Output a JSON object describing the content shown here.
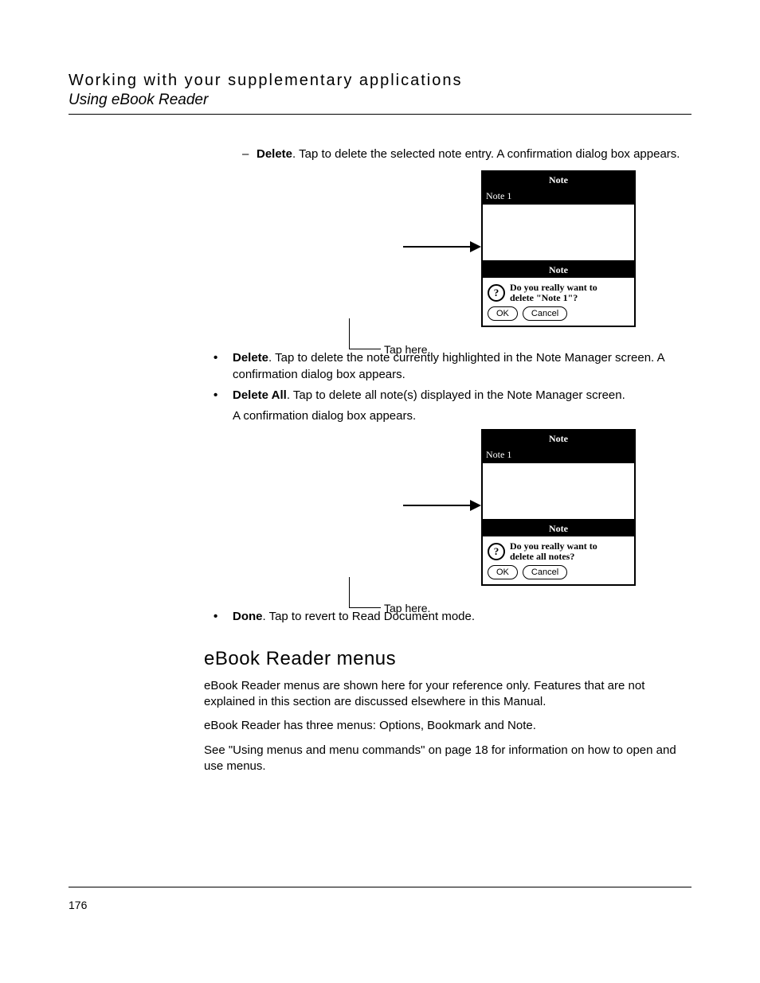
{
  "header": {
    "title": "Working with your supplementary applications",
    "subtitle": "Using eBook Reader"
  },
  "dash1": {
    "label": "Delete",
    "text": ". Tap to delete the selected note entry. A confirmation dialog box appears."
  },
  "figure1": {
    "windowTitle": "Note",
    "listItem": "Note 1",
    "dialogTitle": "Note",
    "msgLine1": "Do you really want to",
    "msgLine2": "delete \"Note 1\"?",
    "ok": "OK",
    "cancel": "Cancel",
    "tap": "Tap here."
  },
  "bulletDelete": {
    "label": "Delete",
    "text": ". Tap to delete the note currently highlighted in the Note Manager screen. A confirmation dialog box appears."
  },
  "bulletDeleteAll": {
    "label": "Delete All",
    "text": ". Tap to delete all note(s) displayed in the Note Manager screen.",
    "text2": "A confirmation dialog box appears."
  },
  "figure2": {
    "windowTitle": "Note",
    "listItem": "Note 1",
    "dialogTitle": "Note",
    "msgLine1": "Do you really want to",
    "msgLine2": "delete all notes?",
    "ok": "OK",
    "cancel": "Cancel",
    "tap": "Tap here."
  },
  "bulletDone": {
    "label": "Done",
    "text": ". Tap to revert to Read Document mode."
  },
  "section": {
    "heading": "eBook Reader menus",
    "p1": "eBook Reader menus are shown here for your reference only. Features that are not explained in this section are discussed elsewhere in this Manual.",
    "p2": "eBook Reader has three menus: Options, Bookmark and Note.",
    "p3": "See \"Using menus and menu commands\" on page 18 for information on how to open and use menus."
  },
  "pageNumber": "176"
}
